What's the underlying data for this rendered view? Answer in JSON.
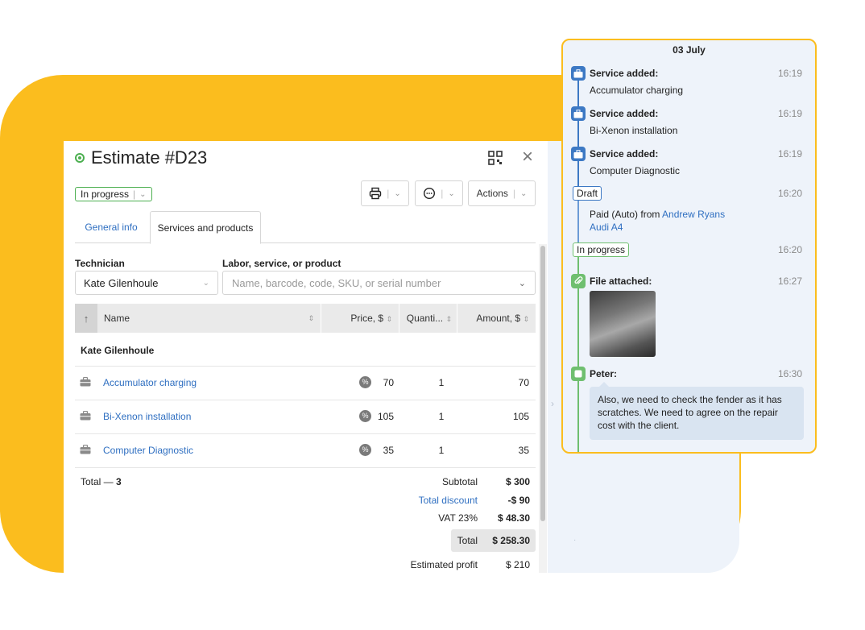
{
  "estimate": {
    "title": "Estimate #D23",
    "status": "In progress",
    "actions_label": "Actions",
    "tabs": [
      {
        "label": "General info"
      },
      {
        "label": "Services and products"
      }
    ],
    "technician_label": "Technician",
    "technician_value": "Kate Gilenhoule",
    "product_label": "Labor, service, or product",
    "product_placeholder": "Name, barcode, code, SKU, or serial number",
    "columns": {
      "sort_arrow": "↑",
      "name": "Name",
      "price": "Price, $",
      "quantity": "Quanti...",
      "amount": "Amount, $"
    },
    "group_title": "Kate Gilenhoule",
    "rows": [
      {
        "name": "Accumulator charging",
        "price": "70",
        "quantity": "1",
        "amount": "70"
      },
      {
        "name": "Bi-Xenon installation",
        "price": "105",
        "quantity": "1",
        "amount": "105"
      },
      {
        "name": "Computer Diagnostic",
        "price": "35",
        "quantity": "1",
        "amount": "35"
      }
    ],
    "total_prefix": "Total — ",
    "total_count": "3",
    "summary": {
      "subtotal_label": "Subtotal",
      "subtotal_value": "$ 300",
      "discount_label": "Total discount",
      "discount_value": "-$ 90",
      "vat_label": "VAT 23%",
      "vat_value": "$ 48.30",
      "total_label": "Total",
      "total_value": "$ 258.30",
      "profit_label": "Estimated profit",
      "profit_value": "$ 210"
    }
  },
  "timeline": {
    "date": "03 July",
    "events": [
      {
        "title": "Service added:",
        "detail": "Accumulator charging",
        "time": "16:19"
      },
      {
        "title": "Service added:",
        "detail": "Bi-Xenon installation",
        "time": "16:19"
      },
      {
        "title": "Service added:",
        "detail": "Computer Diagnostic",
        "time": "16:19"
      }
    ],
    "draft_tag": "Draft",
    "draft_time": "16:20",
    "draft_text": "Paid (Auto) from ",
    "draft_person": "Andrew Ryans",
    "draft_car": "Audi A4",
    "progress_tag": "In progress",
    "progress_time": "16:20",
    "file_title": "File attached:",
    "file_time": "16:27",
    "comment_author": "Peter:",
    "comment_time": "16:30",
    "comment_text": "Also, we need to check the fender as it has scratches. We need to agree on the repair cost with the client."
  },
  "colors": {
    "brand_yellow": "#fbbd1e",
    "link_blue": "#2f6fc1",
    "status_green": "#4caf50",
    "service_icon_blue": "#3d79c4"
  }
}
